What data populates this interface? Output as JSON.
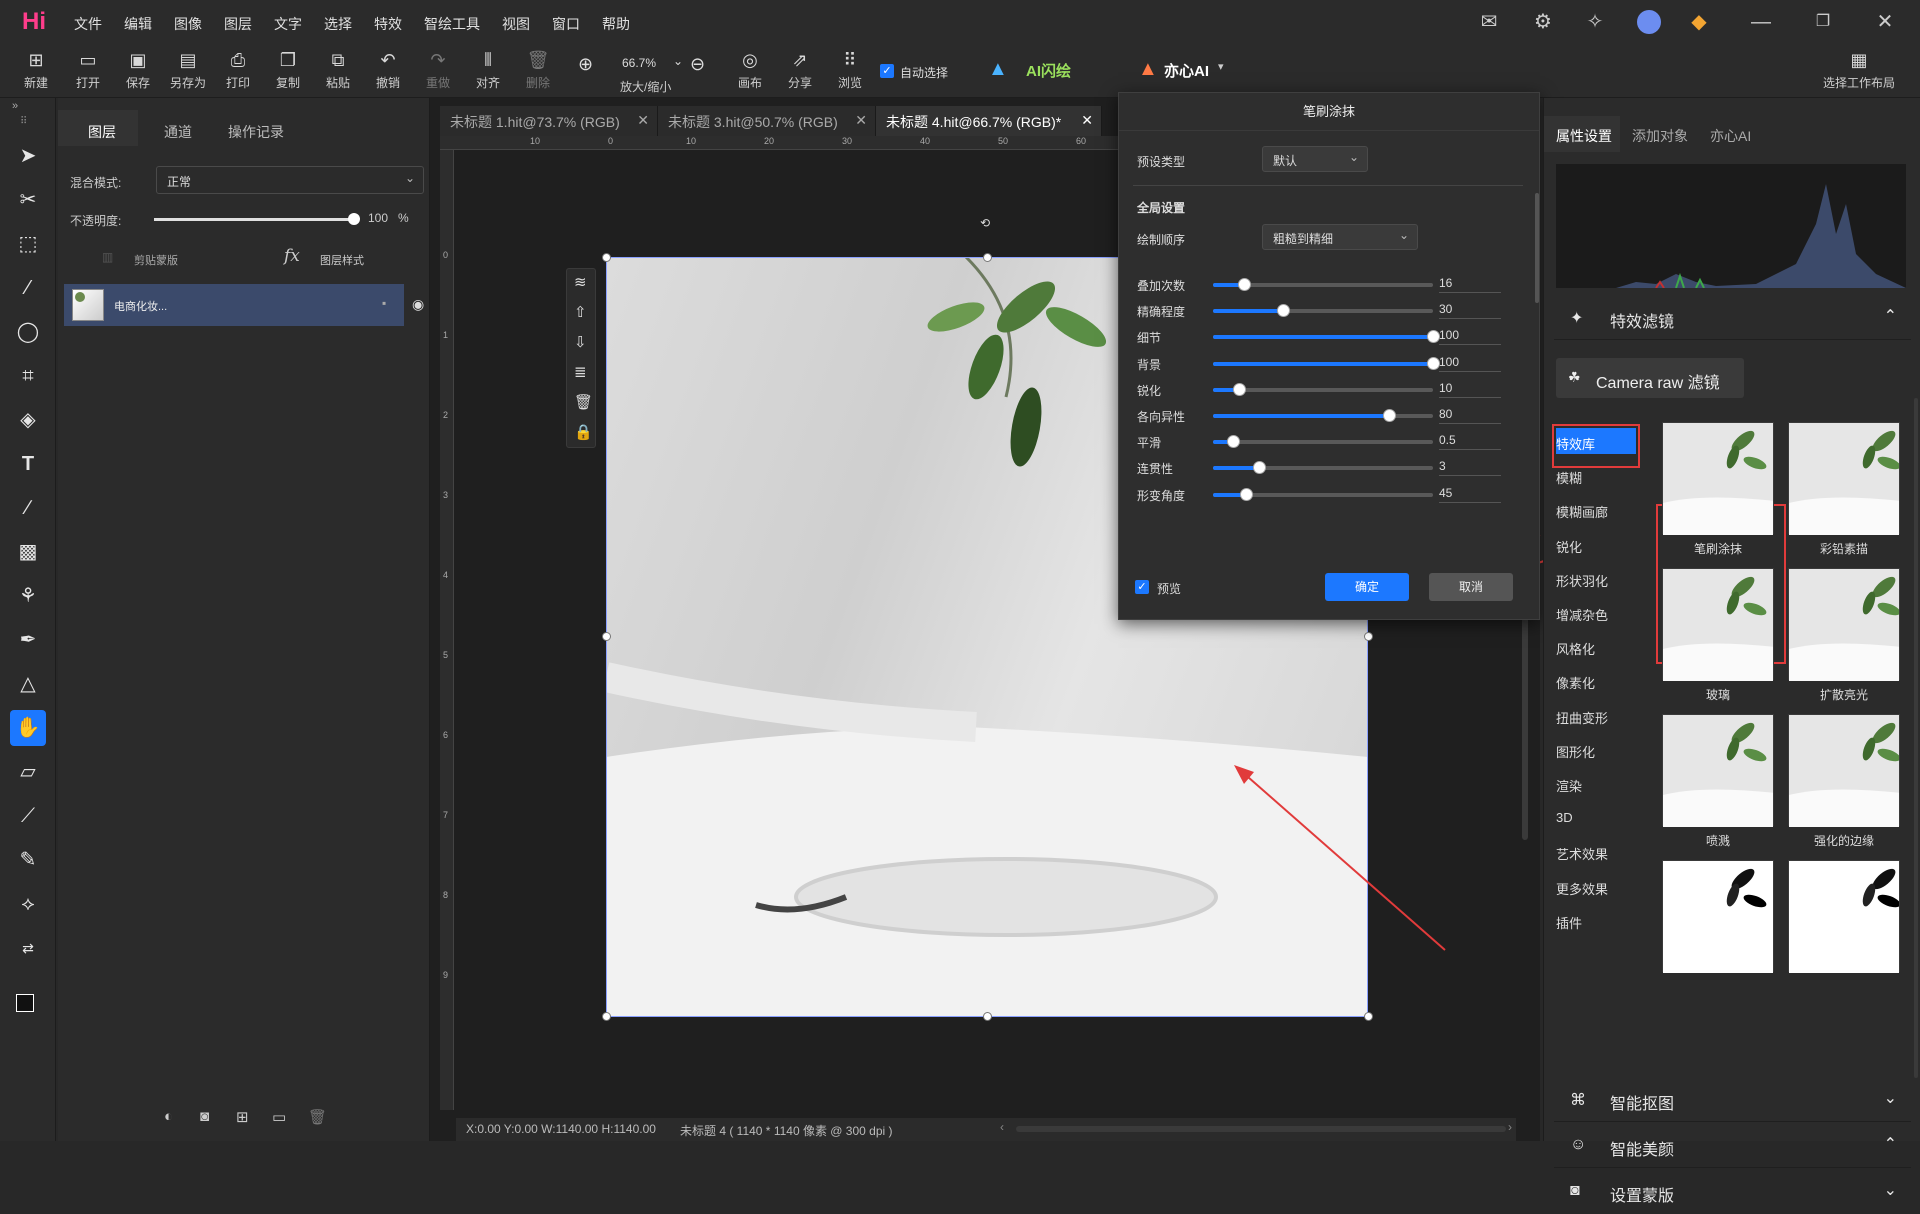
{
  "menubar": {
    "logo": "Hi",
    "items": [
      "文件",
      "编辑",
      "图像",
      "图层",
      "文字",
      "选择",
      "特效",
      "智绘工具",
      "视图",
      "窗口",
      "帮助"
    ]
  },
  "toolbar": {
    "buttons": [
      {
        "label": "新建",
        "icon": "new-icon"
      },
      {
        "label": "打开",
        "icon": "folder-open-icon"
      },
      {
        "label": "保存",
        "icon": "save-icon"
      },
      {
        "label": "另存为",
        "icon": "save-as-icon"
      },
      {
        "label": "打印",
        "icon": "print-icon"
      },
      {
        "label": "复制",
        "icon": "copy-icon"
      },
      {
        "label": "粘贴",
        "icon": "paste-icon"
      },
      {
        "label": "撤销",
        "icon": "undo-icon"
      },
      {
        "label": "重做",
        "icon": "redo-icon"
      },
      {
        "label": "对齐",
        "icon": "align-icon"
      },
      {
        "label": "删除",
        "icon": "delete-icon"
      }
    ],
    "zoom_value": "66.7%",
    "zoom_label": "放大/缩小",
    "canvas_label": "画布",
    "share_label": "分享",
    "browse_label": "浏览",
    "auto_select_label": "自动选择",
    "ai_flash_label": "AI闪绘",
    "yixin_label": "亦心AI",
    "workspace_label": "选择工作布局"
  },
  "layers_panel": {
    "tabs": [
      "图层",
      "通道",
      "操作记录"
    ],
    "blend_mode_label": "混合模式:",
    "blend_mode_value": "正常",
    "opacity_label": "不透明度:",
    "opacity_value": "100",
    "opacity_unit": "%",
    "opacity_fraction": 1.0,
    "clip_mask_label": "剪贴蒙版",
    "layer_style_label": "图层样式",
    "layer_name": "电商化妆..."
  },
  "documents": {
    "tabs": [
      {
        "label": "未标题 1.hit@73.7% (RGB)"
      },
      {
        "label": "未标题 3.hit@50.7% (RGB)"
      },
      {
        "label": "未标题 4.hit@66.7% (RGB)*"
      }
    ],
    "ruler_top": [
      "10",
      "0",
      "10",
      "20",
      "30",
      "40",
      "50",
      "60"
    ],
    "ruler_left": [
      "0",
      "1",
      "2",
      "3",
      "4",
      "5",
      "6",
      "7",
      "8",
      "9"
    ],
    "status_coords": "X:0.00 Y:0.00 W:1140.00 H:1140.00",
    "status_doc": "未标题 4 ( 1140 * 1140 像素 @ 300 dpi )"
  },
  "dialog": {
    "title": "笔刷涂抹",
    "preset_label": "预设类型",
    "preset_value": "默认",
    "global_label": "全局设置",
    "order_label": "绘制顺序",
    "order_value": "粗糙到精细",
    "sliders": [
      {
        "label": "叠加次数",
        "value": "16",
        "fraction": 0.14
      },
      {
        "label": "精确程度",
        "value": "30",
        "fraction": 0.32
      },
      {
        "label": "细节",
        "value": "100",
        "fraction": 1.0
      },
      {
        "label": "背景",
        "value": "100",
        "fraction": 1.0
      },
      {
        "label": "锐化",
        "value": "10",
        "fraction": 0.12
      },
      {
        "label": "各向异性",
        "value": "80",
        "fraction": 0.8
      },
      {
        "label": "平滑",
        "value": "0.5",
        "fraction": 0.09
      },
      {
        "label": "连贯性",
        "value": "3",
        "fraction": 0.21
      },
      {
        "label": "形变角度",
        "value": "45",
        "fraction": 0.15
      }
    ],
    "preview_label": "预览",
    "ok_label": "确定",
    "cancel_label": "取消"
  },
  "right_panel": {
    "tabs": [
      "属性设置",
      "添加对象",
      "亦心AI"
    ],
    "effects_section": "特效滤镜",
    "camera_raw_label": "Camera raw 滤镜",
    "categories": [
      "特效库",
      "模糊",
      "模糊画廊",
      "锐化",
      "形状羽化",
      "增减杂色",
      "风格化",
      "像素化",
      "扭曲变形",
      "图形化",
      "渲染",
      "3D",
      "艺术效果",
      "更多效果",
      "插件"
    ],
    "thumbnails": [
      "笔刷涂抹",
      "彩铅素描",
      "玻璃",
      "扩散亮光",
      "喷溅",
      "强化的边缘",
      "",
      ""
    ],
    "sections": [
      "智能抠图",
      "智能美颜",
      "设置蒙版"
    ]
  }
}
